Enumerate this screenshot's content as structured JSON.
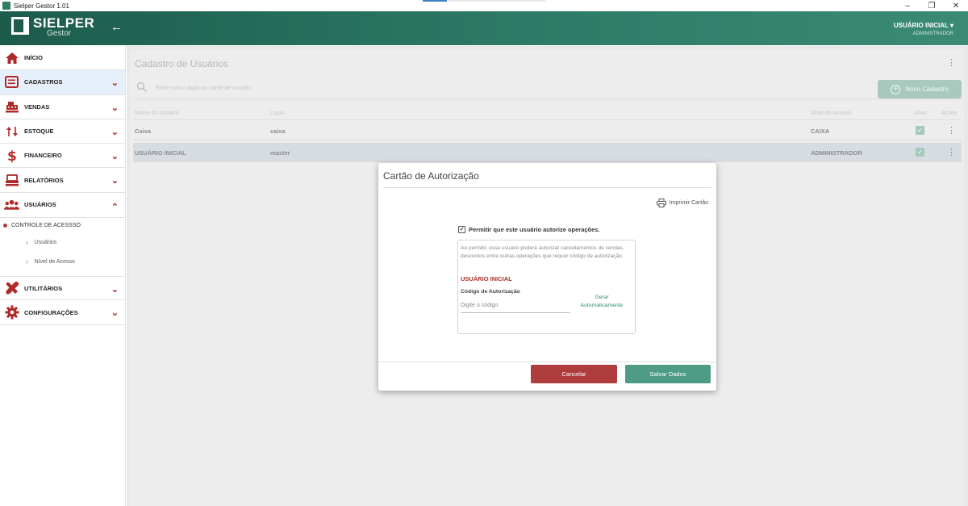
{
  "window": {
    "title": "Sielper Gestor 1.01",
    "minimize": "–",
    "restore": "❐",
    "close": "✕"
  },
  "header": {
    "logo_text": "SIELPER",
    "logo_sub": "Gestor",
    "back": "←",
    "user_name": "USUÁRIO INICIAL",
    "user_role": "ADMINISTRADOR",
    "user_caret": "▾"
  },
  "sidebar": {
    "items": [
      {
        "label": "INÍCIO",
        "icon": "home-icon"
      },
      {
        "label": "CADASTROS",
        "icon": "id-card-icon"
      },
      {
        "label": "VENDAS",
        "icon": "cash-register-icon"
      },
      {
        "label": "ESTOQUE",
        "icon": "sort-arrows-icon"
      },
      {
        "label": "FINANCEIRO",
        "icon": "dollar-icon"
      },
      {
        "label": "RELATÓRIOS",
        "icon": "report-icon"
      },
      {
        "label": "USUÁRIOS",
        "icon": "users-icon"
      },
      {
        "label": "UTILITÁRIOS",
        "icon": "tools-icon"
      },
      {
        "label": "CONFIGURAÇÕES",
        "icon": "gear-icon"
      }
    ],
    "chevron_down": "⌄",
    "chevron_up": "⌃",
    "submenu_title": "CONTROLE DE ACESSSO",
    "submenu_items": [
      "Usuários",
      "Nível de Acesso"
    ],
    "submenu_arrow": "›"
  },
  "main": {
    "title": "Cadastro de Usuários",
    "search_placeholder": "Entre com o login ou nome de usuário",
    "new_button": "Novo Cadastro",
    "kebab": "⋮",
    "columns": [
      "Nome do Usuário",
      "Login",
      "Nível de Acesso",
      "Ativo",
      "Ações"
    ],
    "rows": [
      {
        "name": "Caixa",
        "login": "caixa",
        "level": "CAIXA",
        "active": "✓"
      },
      {
        "name": "USUÁRIO INICIAL",
        "login": "master",
        "level": "ADMINISTRADOR",
        "active": "✓"
      }
    ]
  },
  "modal": {
    "title": "Cartão de Autorização",
    "print_label": "Imprimir Cartão",
    "permission_check": "✓",
    "permission_label": "Permitir que este usuário autorize operações.",
    "description": "Ao permitir, esse usuário poderá autorizar cancelamentos de vendas, descontos entre outras operações que requer código de autorização.",
    "user_name": "USUÁRIO INICIAL",
    "code_label": "Código de Autorização",
    "code_placeholder": "Digite o código",
    "generate_link": "Gerar Automaticamente",
    "cancel_button": "Cancelar",
    "save_button": "Salvar Dados"
  },
  "colors": {
    "header_green": "#2d7b66",
    "accent_red": "#b03d3d",
    "save_green": "#4e9c86",
    "active_menu_bg": "#e6f0fa"
  }
}
